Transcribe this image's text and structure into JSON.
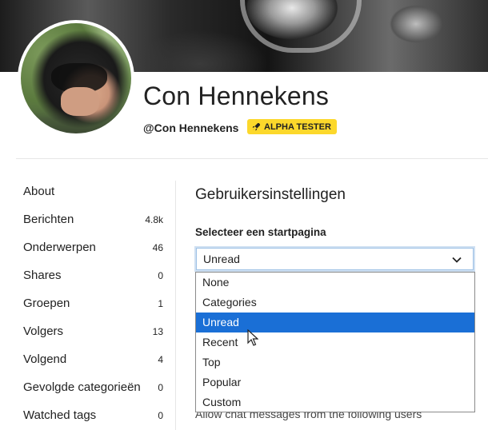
{
  "profile": {
    "name": "Con Hennekens",
    "handle": "@Con Hennekens",
    "badge": "ALPHA TESTER",
    "badge_color": "#fcd82b",
    "badge_icon": "rocket-icon"
  },
  "nav": {
    "items": [
      {
        "label": "About",
        "count": ""
      },
      {
        "label": "Berichten",
        "count": "4.8k"
      },
      {
        "label": "Onderwerpen",
        "count": "46"
      },
      {
        "label": "Shares",
        "count": "0"
      },
      {
        "label": "Groepen",
        "count": "1"
      },
      {
        "label": "Volgers",
        "count": "13"
      },
      {
        "label": "Volgend",
        "count": "4"
      },
      {
        "label": "Gevolgde categorieën",
        "count": "0"
      },
      {
        "label": "Watched tags",
        "count": "0"
      }
    ]
  },
  "settings": {
    "title": "Gebruikersinstellingen",
    "start_page_label": "Selecteer een startpagina",
    "start_page_value": "Unread",
    "options": [
      "None",
      "Categories",
      "Unread",
      "Recent",
      "Top",
      "Popular",
      "Custom"
    ],
    "selected_option": "Unread",
    "selected_color": "#1a6fd6",
    "partially_hidden_text": "Allow chat messages from the following users"
  }
}
